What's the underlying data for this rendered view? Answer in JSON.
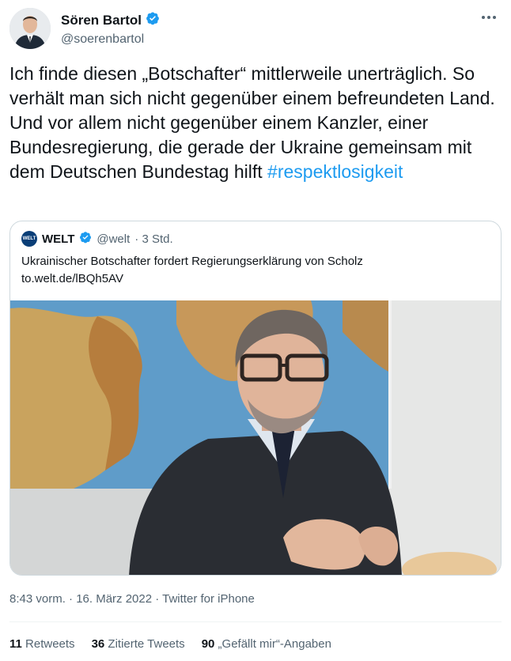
{
  "author": {
    "display_name": "Sören Bartol",
    "handle": "@soerenbartol",
    "verified": true
  },
  "tweet": {
    "text": "Ich finde diesen „Botschafter“ mittlerweile unerträglich. So verhält man sich nicht gegenüber einem befreundeten Land. Und vor allem nicht gegenüber einem Kanzler, einer Bundesregierung, die gerade der Ukraine gemeinsam mit dem Deutschen Bundestag hilft ",
    "hashtag": "#respektlosigkeit",
    "timestamp": "8:43 vorm. · 16. März 2022 · Twitter for iPhone"
  },
  "quoted": {
    "logo_text": "WELT",
    "name": "WELT",
    "handle": "@welt",
    "age": "· 3 Std.",
    "text": "Ukrainischer Botschafter fordert Regierungserklärung von Scholz",
    "link": "to.welt.de/lBQh5AV"
  },
  "stats": {
    "retweets_count": "11",
    "retweets_label": "Retweets",
    "quotes_count": "36",
    "quotes_label": "Zitierte Tweets",
    "likes_count": "90",
    "likes_label": "„Gefällt mir“-Angaben"
  },
  "colors": {
    "accent": "#1d9bf0",
    "text": "#0f1419",
    "secondary": "#536471",
    "border": "#cfd9de"
  },
  "icons": [
    "verified-badge-icon",
    "more-options-icon",
    "welt-logo-icon"
  ]
}
